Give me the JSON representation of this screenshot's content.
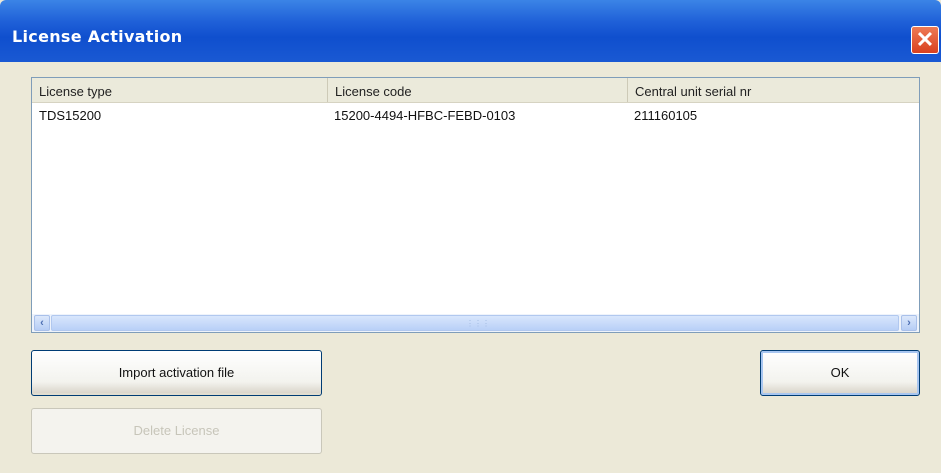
{
  "window": {
    "title": "License Activation",
    "close_icon": "close-icon"
  },
  "license_list": {
    "columns": [
      "License type",
      "License code",
      "Central unit serial nr"
    ],
    "rows": [
      {
        "license_type": "TDS15200",
        "license_code": "15200-4494-HFBC-FEBD-0103",
        "serial": "211160105"
      }
    ],
    "scrollbar_left_glyph": "‹",
    "scrollbar_right_glyph": "›"
  },
  "buttons": {
    "import_label": "Import activation file",
    "ok_label": "OK",
    "delete_label": "Delete License"
  },
  "colors": {
    "titlebar": "#1f60d8",
    "close": "#d9401f",
    "window_bg": "#ece9d8"
  }
}
